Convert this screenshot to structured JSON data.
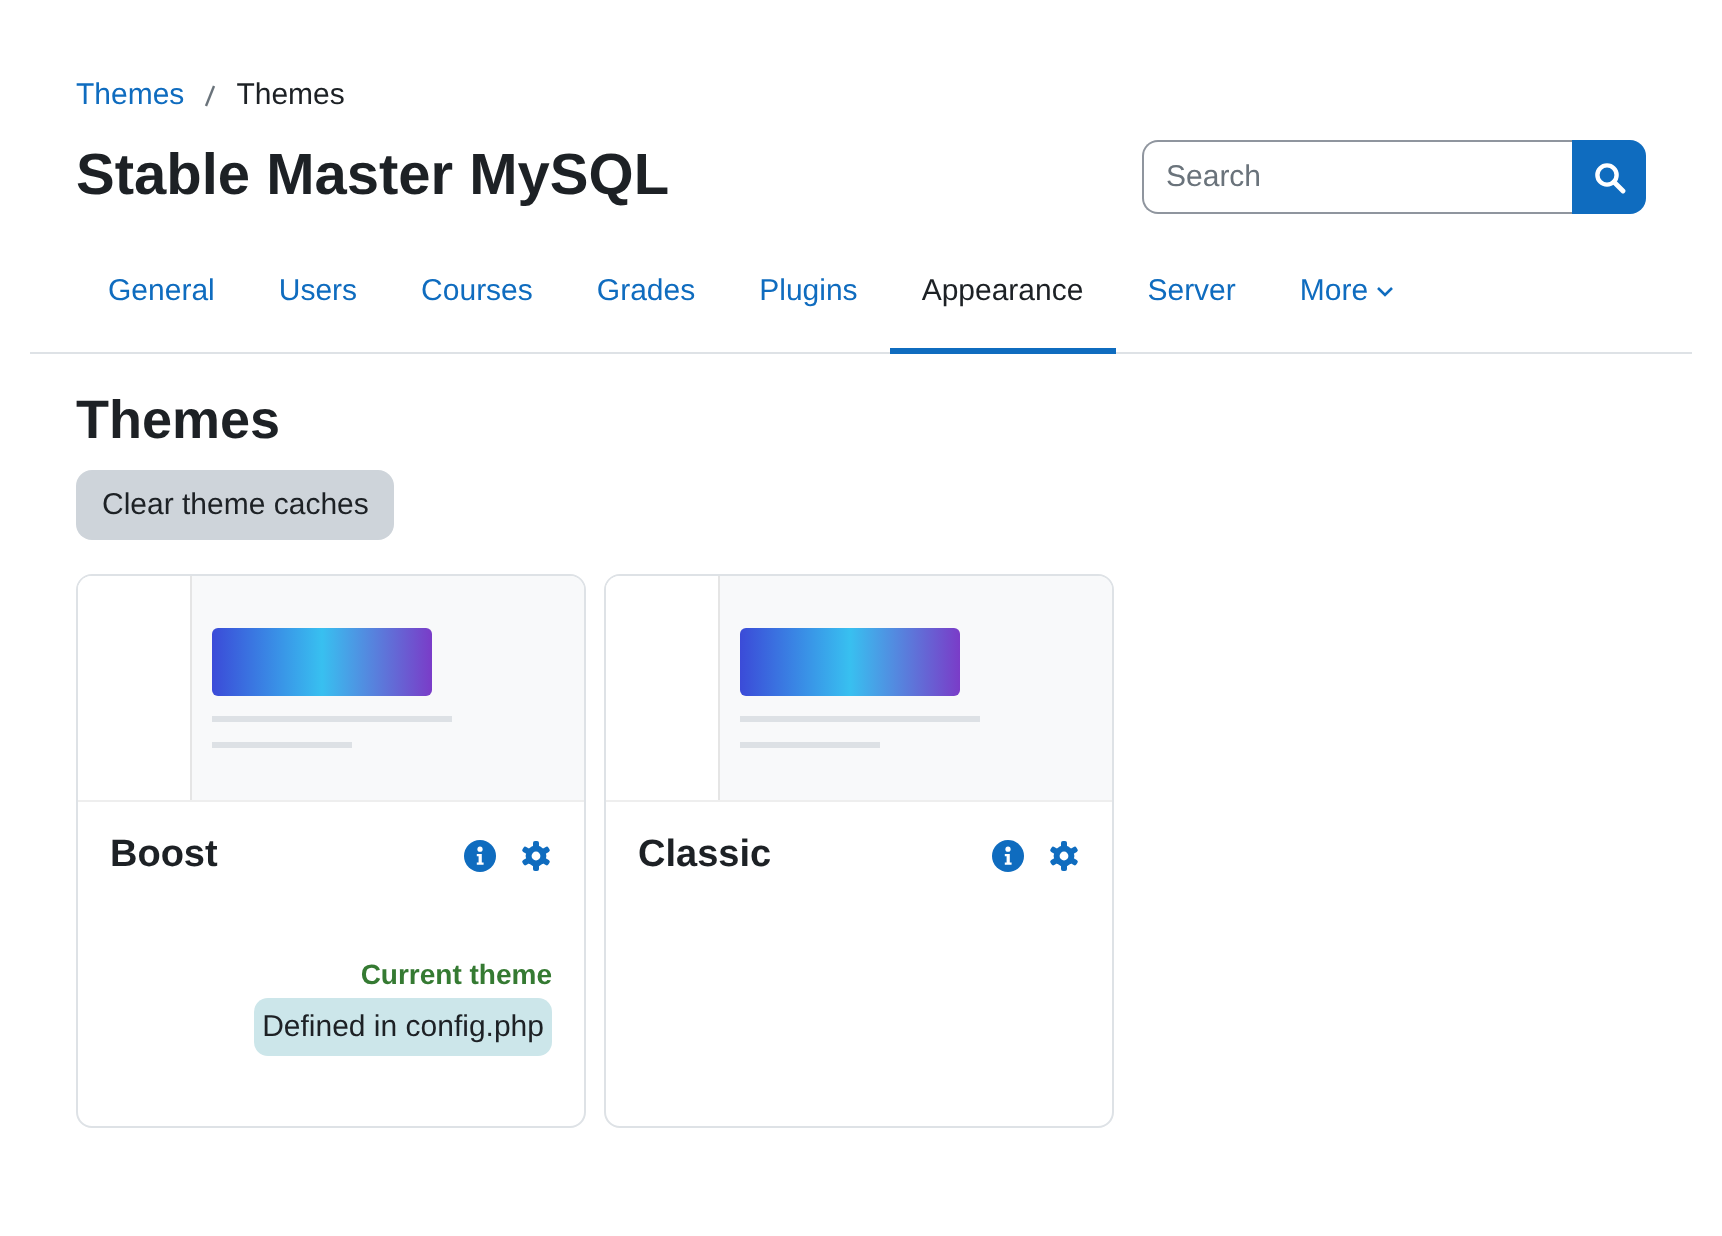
{
  "breadcrumb": [
    {
      "label": "Themes",
      "link": true
    },
    {
      "label": "Themes",
      "link": false
    }
  ],
  "site_title": "Stable Master MySQL",
  "search": {
    "placeholder": "Search"
  },
  "tabs": [
    {
      "label": "General",
      "selected": false
    },
    {
      "label": "Users",
      "selected": false
    },
    {
      "label": "Courses",
      "selected": false
    },
    {
      "label": "Grades",
      "selected": false
    },
    {
      "label": "Plugins",
      "selected": false
    },
    {
      "label": "Appearance",
      "selected": true
    },
    {
      "label": "Server",
      "selected": false
    },
    {
      "label": "More",
      "selected": false,
      "kind": "dropdown"
    }
  ],
  "heading": "Themes",
  "clear_button": "Clear theme caches",
  "themes": [
    {
      "name": "Boost",
      "current": true,
      "current_label": "Current theme",
      "note": "Defined in config.php"
    },
    {
      "name": "Classic",
      "current": false
    }
  ]
}
